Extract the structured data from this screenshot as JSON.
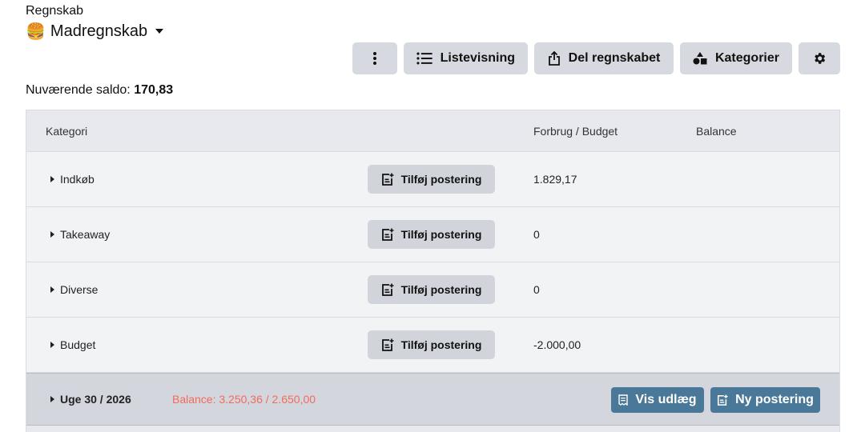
{
  "header": {
    "subtitle": "Regnskab",
    "emoji": "🍔",
    "title": "Madregnskab"
  },
  "toolbar": {
    "more_icon": "vertical-dots-icon",
    "list_label": "Listevisning",
    "share_label": "Del regnskabet",
    "categories_label": "Kategorier",
    "settings_icon": "gear-icon"
  },
  "saldo": {
    "label": "Nuværende saldo:",
    "value": "170,83"
  },
  "table": {
    "headers": {
      "category": "Kategori",
      "spend_budget": "Forbrug / Budget",
      "balance": "Balance"
    },
    "add_label": "Tilføj postering",
    "rows": [
      {
        "name": "Indkøb",
        "amount": "1.829,17"
      },
      {
        "name": "Takeaway",
        "amount": "0"
      },
      {
        "name": "Diverse",
        "amount": "0"
      },
      {
        "name": "Budget",
        "amount": "-2.000,00"
      }
    ]
  },
  "week": {
    "label": "Uge 30 / 2026",
    "balance_text": "Balance: 3.250,36  / 2.650,00",
    "balance_color": "#f26b60",
    "show_expenses_label": "Vis udlæg",
    "new_entry_label": "Ny postering"
  },
  "colors": {
    "primary_button": "#4a7898",
    "secondary_button": "#d6d9df"
  }
}
